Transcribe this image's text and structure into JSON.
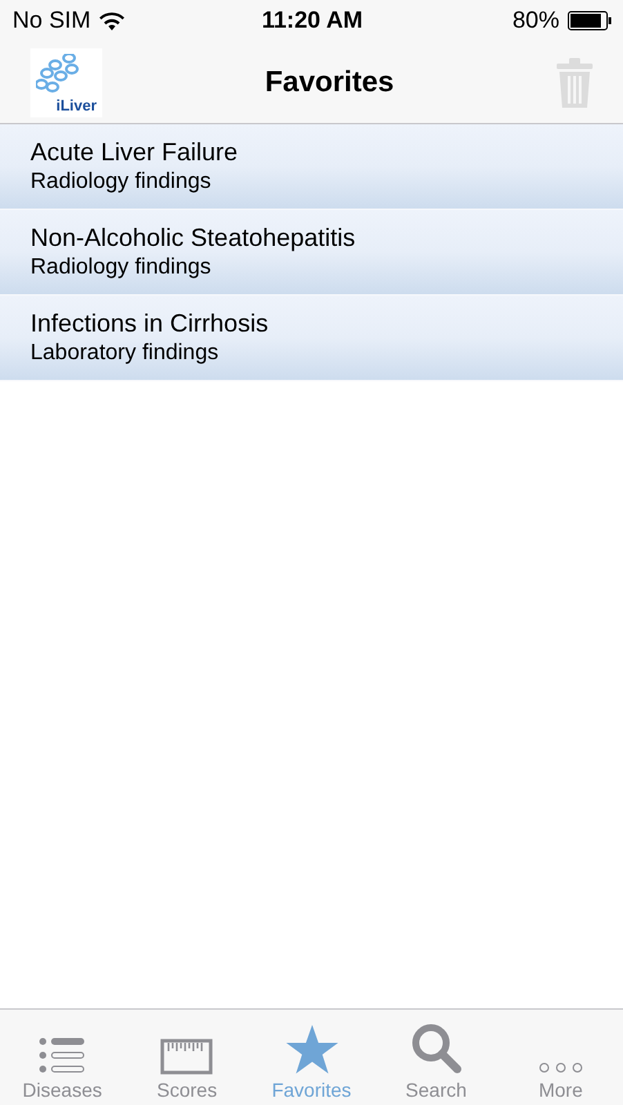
{
  "status_bar": {
    "carrier": "No SIM",
    "time": "11:20 AM",
    "battery": "80%"
  },
  "nav_bar": {
    "logo_text": "iLiver",
    "title": "Favorites",
    "delete_disabled": true
  },
  "favorites": [
    {
      "title": "Acute Liver Failure",
      "subtitle": "Radiology findings"
    },
    {
      "title": "Non-Alcoholic Steatohepatitis",
      "subtitle": "Radiology findings"
    },
    {
      "title": "Infections in Cirrhosis",
      "subtitle": "Laboratory findings"
    }
  ],
  "tab_bar": [
    {
      "kind": "list",
      "label": "Diseases",
      "selected": false
    },
    {
      "kind": "ruler",
      "label": "Scores",
      "selected": false
    },
    {
      "kind": "star",
      "label": "Favorites",
      "selected": true
    },
    {
      "kind": "search",
      "label": "Search",
      "selected": false
    },
    {
      "kind": "more",
      "label": "More",
      "selected": false
    }
  ]
}
